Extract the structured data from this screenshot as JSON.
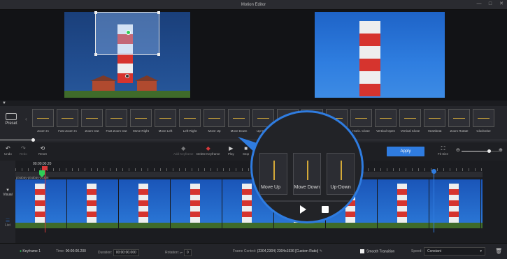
{
  "window": {
    "title": "Motion Editor",
    "controls": [
      "—",
      "□",
      "✕"
    ]
  },
  "presets": {
    "label": "Preset",
    "tiles": [
      "Zoom In",
      "Fast Zoom In",
      "Zoom Out",
      "Fast Zoom Out",
      "Move Right",
      "Move Left",
      "Left-Right",
      "Move Up",
      "Move Down",
      "Up-Down",
      "",
      "",
      "Horiz. Open",
      "Horiz. Close",
      "Vertical Open",
      "Vertical Close",
      "Heartbeat",
      "Zoom Rotate",
      "Clockwise"
    ]
  },
  "toolbar": {
    "undo": "Undo",
    "redo": "Redo",
    "reset": "Reset",
    "add_keyframe": "Add Keyframe",
    "delete_keyframe": "Delete Keyframe",
    "play": "Play",
    "stop": "Stop",
    "apply": "Apply",
    "fit_size": "Fit Size"
  },
  "timeline": {
    "sidebar": {
      "visual": "Visual",
      "list": "List"
    },
    "current_time": "00:00:00.20",
    "clip_name": "pixabay-pixabay-20336"
  },
  "magnifier": {
    "labels": [
      "Move Up",
      "Move Down",
      "Up-Down"
    ]
  },
  "bottom": {
    "keyframe": "Keyframe 1",
    "time_label": "Time:",
    "time_value": "00:00:00.200",
    "duration_label": "Duration:",
    "duration_value": "00:00:00.000",
    "rotation_label": "Rotation:",
    "rotation_value": "0",
    "frame_control_label": "Frame Control:",
    "frame_control_value": "(2304,2304)  2304x1536  [Custom Ratio]",
    "smooth_transition": "Smooth Transition",
    "smooth_checked": true,
    "speed_label": "Speed:",
    "speed_value": "Constant"
  },
  "colors": {
    "accent": "#2f7ce0",
    "playhead": "#d8393a",
    "keyframe": "#2dcf57"
  }
}
